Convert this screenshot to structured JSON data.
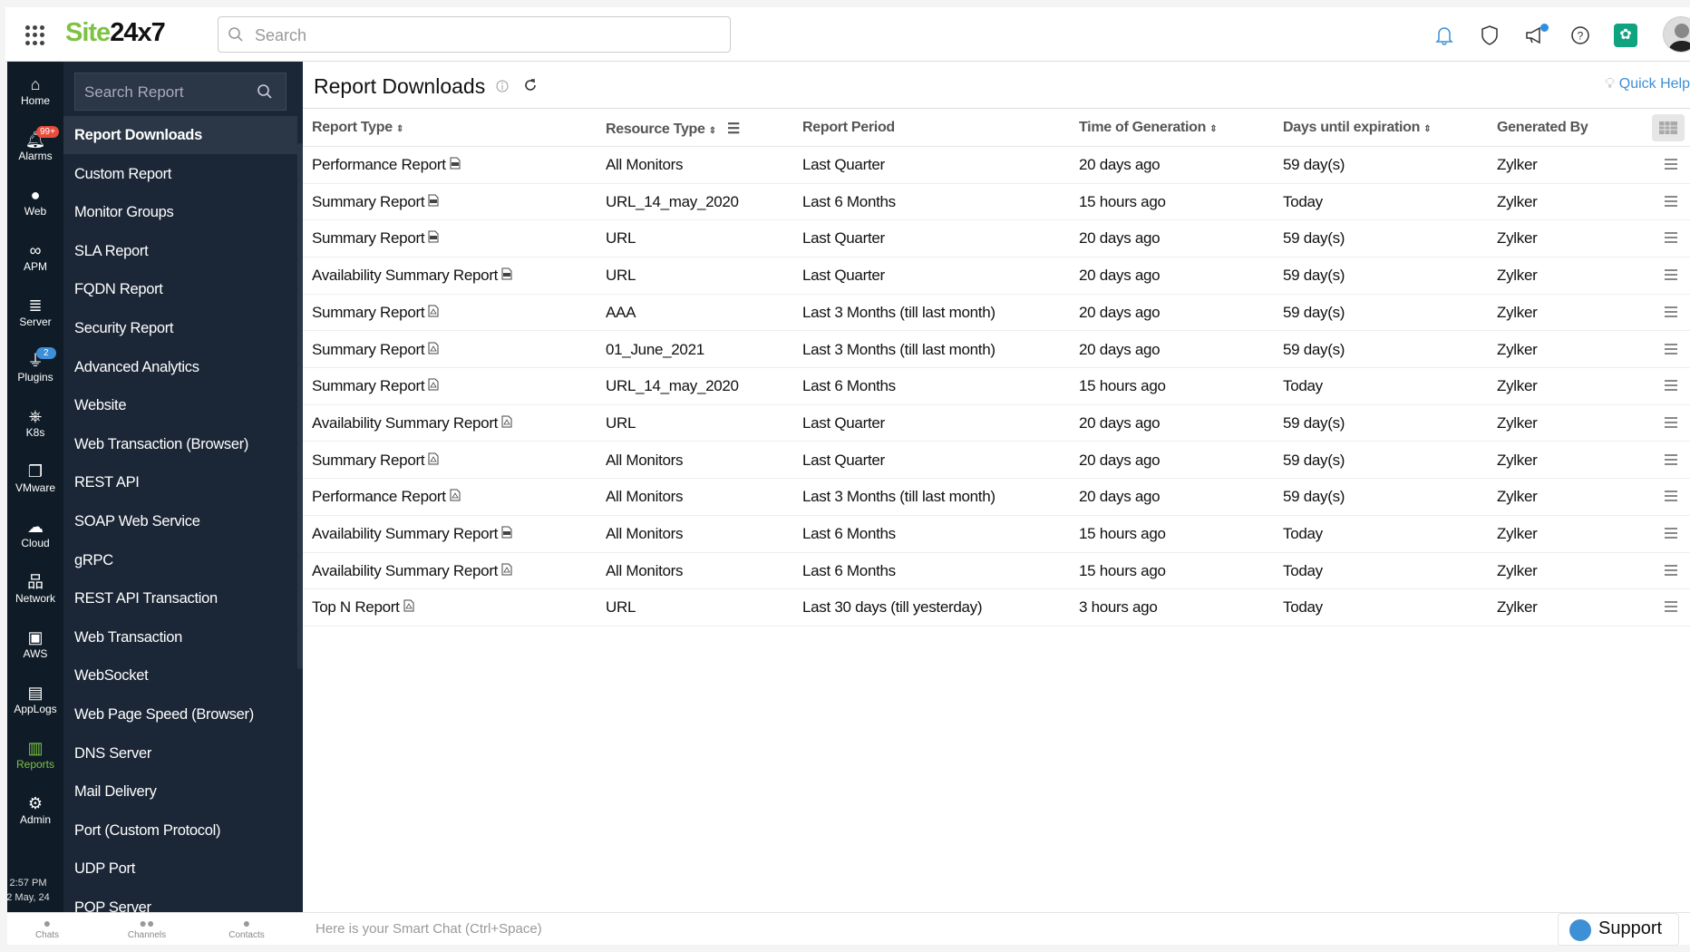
{
  "header": {
    "logo_green": "Site",
    "logo_black": "24x7",
    "search_placeholder": "Search"
  },
  "rail": {
    "items": [
      {
        "label": "Home",
        "icon": "home-icon"
      },
      {
        "label": "Alarms",
        "icon": "bell-icon",
        "badge": "99+"
      },
      {
        "label": "Web",
        "icon": "globe-icon"
      },
      {
        "label": "APM",
        "icon": "binoculars-icon"
      },
      {
        "label": "Server",
        "icon": "server-icon"
      },
      {
        "label": "Plugins",
        "icon": "plug-icon",
        "badge": "2"
      },
      {
        "label": "K8s",
        "icon": "kubernetes-icon"
      },
      {
        "label": "VMware",
        "icon": "vmware-icon"
      },
      {
        "label": "Cloud",
        "icon": "cloud-icon"
      },
      {
        "label": "Network",
        "icon": "network-icon"
      },
      {
        "label": "AWS",
        "icon": "aws-icon"
      },
      {
        "label": "AppLogs",
        "icon": "applogs-icon"
      },
      {
        "label": "Reports",
        "icon": "reports-icon"
      },
      {
        "label": "Admin",
        "icon": "gear-icon"
      }
    ],
    "time": "2:57 PM",
    "date": "2 May, 24"
  },
  "menu": {
    "search_placeholder": "Search Report",
    "items": [
      "Report Downloads",
      "Custom Report",
      "Monitor Groups",
      "SLA Report",
      "FQDN Report",
      "Security Report",
      "Advanced Analytics",
      "Website",
      "Web Transaction (Browser)",
      "REST API",
      "SOAP Web Service",
      "gRPC",
      "REST API Transaction",
      "Web Transaction",
      "WebSocket",
      "Web Page Speed (Browser)",
      "DNS Server",
      "Mail Delivery",
      "Port (Custom Protocol)",
      "UDP Port",
      "POP Server"
    ]
  },
  "main": {
    "title": "Report Downloads",
    "quick_help": "Quick Help",
    "columns": [
      "Report Type",
      "Resource Type",
      "Report Period",
      "Time of Generation",
      "Days until expiration",
      "Generated By"
    ],
    "rows": [
      [
        "Performance Report",
        "csv",
        "All Monitors",
        "Last Quarter",
        "20 days ago",
        "59 day(s)",
        "Zylker"
      ],
      [
        "Summary Report",
        "csv",
        "URL_14_may_2020",
        "Last 6 Months",
        "15 hours ago",
        "Today",
        "Zylker"
      ],
      [
        "Summary Report",
        "csv",
        "URL",
        "Last Quarter",
        "20 days ago",
        "59 day(s)",
        "Zylker"
      ],
      [
        "Availability Summary Report",
        "csv",
        "URL",
        "Last Quarter",
        "20 days ago",
        "59 day(s)",
        "Zylker"
      ],
      [
        "Summary Report",
        "pdf",
        "AAA",
        "Last 3 Months (till last month)",
        "20 days ago",
        "59 day(s)",
        "Zylker"
      ],
      [
        "Summary Report",
        "pdf",
        "01_June_2021",
        "Last 3 Months (till last month)",
        "20 days ago",
        "59 day(s)",
        "Zylker"
      ],
      [
        "Summary Report",
        "pdf",
        "URL_14_may_2020",
        "Last 6 Months",
        "15 hours ago",
        "Today",
        "Zylker"
      ],
      [
        "Availability Summary Report",
        "pdf",
        "URL",
        "Last Quarter",
        "20 days ago",
        "59 day(s)",
        "Zylker"
      ],
      [
        "Summary Report",
        "pdf",
        "All Monitors",
        "Last Quarter",
        "20 days ago",
        "59 day(s)",
        "Zylker"
      ],
      [
        "Performance Report",
        "pdf",
        "All Monitors",
        "Last 3 Months (till last month)",
        "20 days ago",
        "59 day(s)",
        "Zylker"
      ],
      [
        "Availability Summary Report",
        "csv",
        "All Monitors",
        "Last 6 Months",
        "15 hours ago",
        "Today",
        "Zylker"
      ],
      [
        "Availability Summary Report",
        "pdf",
        "All Monitors",
        "Last 6 Months",
        "15 hours ago",
        "Today",
        "Zylker"
      ],
      [
        "Top N Report",
        "pdf",
        "URL",
        "Last 30 days (till yesterday)",
        "3 hours ago",
        "Today",
        "Zylker"
      ]
    ]
  },
  "bottom": {
    "tabs": [
      "Chats",
      "Channels",
      "Contacts"
    ],
    "chat_placeholder": "Here is your Smart Chat (Ctrl+Space)",
    "support": "Support"
  },
  "colors": {
    "brand_green": "#7dc242",
    "rail_bg": "#0f1c27",
    "menu_bg": "#1b2636",
    "accent_blue": "#3d8fd6"
  }
}
